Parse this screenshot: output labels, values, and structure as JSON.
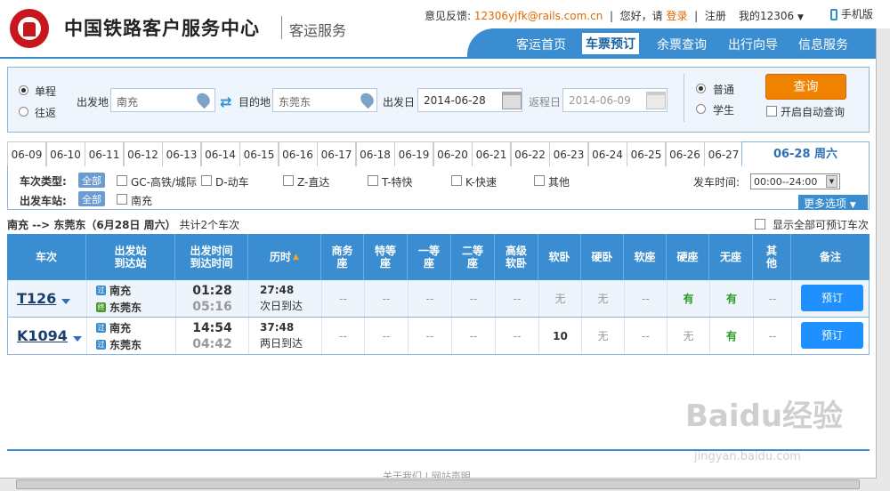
{
  "header": {
    "title": "中国铁路客户服务中心",
    "subtitle": "客运服务",
    "feedback_label": "意见反馈:",
    "feedback_email": "12306yjfk@rails.com.cn",
    "greeting": "您好，请",
    "login": "登录",
    "register": "注册",
    "my12306": "我的12306",
    "mobile": "手机版"
  },
  "nav": [
    {
      "label": "客运首页"
    },
    {
      "label": "车票预订"
    },
    {
      "label": "余票查询"
    },
    {
      "label": "出行向导"
    },
    {
      "label": "信息服务"
    }
  ],
  "search": {
    "oneway": "单程",
    "roundtrip": "往返",
    "from_label": "出发地",
    "from_value": "南充",
    "to_label": "目的地",
    "to_value": "东莞东",
    "date_label": "出发日",
    "date_value": "2014-06-28",
    "return_label": "返程日",
    "return_value": "2014-06-09",
    "normal": "普通",
    "student": "学生",
    "query_button": "查询",
    "auto_query": "开启自动查询"
  },
  "date_tabs": [
    "06-09",
    "06-10",
    "06-11",
    "06-12",
    "06-13",
    "06-14",
    "06-15",
    "06-16",
    "06-17",
    "06-18",
    "06-19",
    "06-20",
    "06-21",
    "06-22",
    "06-23",
    "06-24",
    "06-25",
    "06-26",
    "06-27"
  ],
  "active_date": "06-28 周六",
  "filters": {
    "train_type_label": "车次类型:",
    "all": "全部",
    "types": [
      "GC-高铁/城际",
      "D-动车",
      "Z-直达",
      "T-特快",
      "K-快速",
      "其他"
    ],
    "station_label": "出发车站:",
    "station_all": "全部",
    "stations": [
      "南充"
    ],
    "depart_time_label": "发车时间:",
    "depart_time_value": "00:00--24:00",
    "more": "更多选项"
  },
  "summary": {
    "route": "南充 --> 东莞东（6月28日 周六）",
    "count_text": "共计2个车次",
    "show_all": "显示全部可预订车次"
  },
  "table": {
    "headers": {
      "train": "车次",
      "station": [
        "出发站",
        "到达站"
      ],
      "time": [
        "出发时间",
        "到达时间"
      ],
      "duration": "历时",
      "seats": [
        "商务座",
        "特等座",
        "一等座",
        "二等座",
        "高级软卧",
        "软卧",
        "硬卧",
        "软座",
        "硬座",
        "无座",
        "其他"
      ],
      "note": "备注"
    },
    "rows": [
      {
        "train": "T126",
        "from_badge": "过",
        "from": "南充",
        "to_badge": "终",
        "to": "东莞东",
        "depart": "01:28",
        "arrive": "05:16",
        "duration": "27:48",
        "duration_note": "次日到达",
        "seats": [
          "--",
          "--",
          "--",
          "--",
          "--",
          "无",
          "无",
          "--",
          "有",
          "有",
          "--"
        ],
        "book": "预订"
      },
      {
        "train": "K1094",
        "from_badge": "过",
        "from": "南充",
        "to_badge": "过",
        "to": "东莞东",
        "depart": "14:54",
        "arrive": "04:42",
        "duration": "37:48",
        "duration_note": "两日到达",
        "seats": [
          "--",
          "--",
          "--",
          "--",
          "--",
          "10",
          "无",
          "--",
          "无",
          "有",
          "--"
        ],
        "book": "预订"
      }
    ]
  },
  "footer": {
    "text": "关于我们 | 网站声明"
  },
  "watermark": {
    "brand": "Baidu经验",
    "url": "jingyan.baidu.com"
  },
  "colors": {
    "primary": "#3a8dd0",
    "accent": "#f08200",
    "brand_red": "#c8161d",
    "available": "#2a9a2a"
  }
}
